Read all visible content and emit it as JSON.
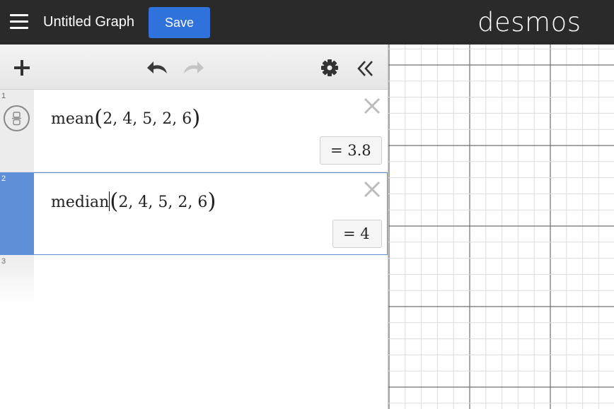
{
  "header": {
    "title": "Untitled Graph",
    "save_label": "Save",
    "logo": "desmos"
  },
  "toolbar": {
    "add_icon": "plus-icon",
    "undo_icon": "undo-icon",
    "redo_icon": "redo-icon",
    "settings_icon": "gear-icon",
    "collapse_icon": "double-chevron-left-icon"
  },
  "expressions": [
    {
      "number": "1",
      "function": "mean",
      "args": "2, 4, 5, 2, 6",
      "result": "= 3.8"
    },
    {
      "number": "2",
      "function": "median",
      "args": "2, 4, 5, 2, 6",
      "result": "= 4"
    },
    {
      "number": "3"
    }
  ],
  "colors": {
    "header_bg": "#2a2a2a",
    "save_button": "#2f72dc",
    "active_expression": "#5f8fd6"
  }
}
